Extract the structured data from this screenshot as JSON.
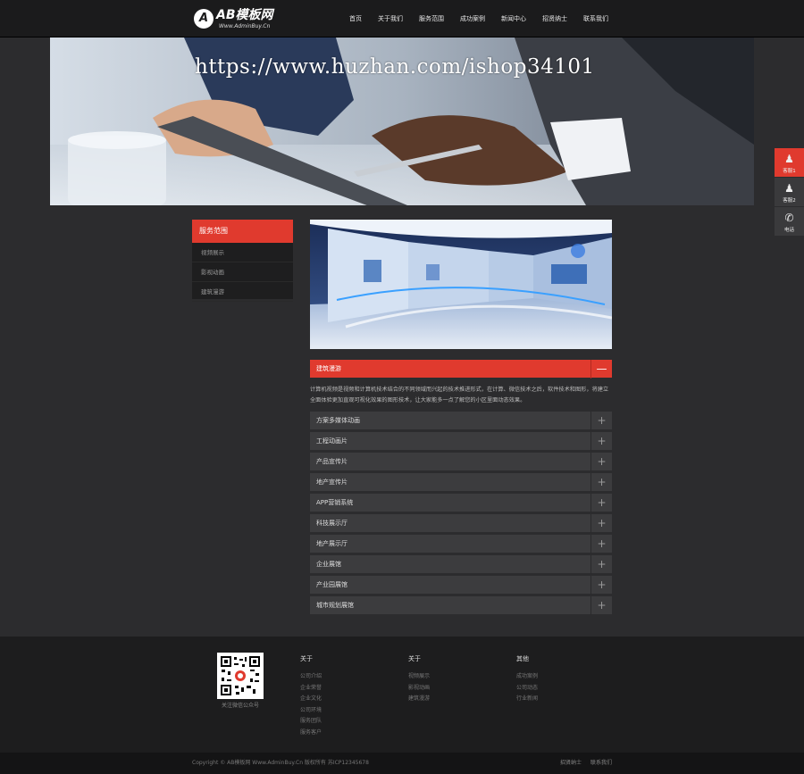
{
  "header": {
    "logo_mark": "A",
    "logo_text": "AB模板网",
    "logo_sub": "Www.AdminBuy.Cn",
    "nav": [
      "首页",
      "关于我们",
      "服务范围",
      "成功案例",
      "新闻中心",
      "招贤纳士",
      "联系我们"
    ]
  },
  "banner": {
    "watermark": "https://www.huzhan.com/ishop34101"
  },
  "sidebar": {
    "title": "服务范围",
    "items": [
      "视频展示",
      "影视动画",
      "建筑漫游"
    ]
  },
  "accordion": {
    "items": [
      {
        "label": "建筑漫游",
        "toggle": "—"
      },
      {
        "label": "方案多媒体动画",
        "toggle": "+"
      },
      {
        "label": "工程动画片",
        "toggle": "+"
      },
      {
        "label": "产品宣传片",
        "toggle": "+"
      },
      {
        "label": "地产宣传片",
        "toggle": "+"
      },
      {
        "label": "APP营销系统",
        "toggle": "+"
      },
      {
        "label": "科技展示厅",
        "toggle": "+"
      },
      {
        "label": "地产展示厅",
        "toggle": "+"
      },
      {
        "label": "企业展馆",
        "toggle": "+"
      },
      {
        "label": "产业园展馆",
        "toggle": "+"
      },
      {
        "label": "城市规划展馆",
        "toggle": "+"
      }
    ],
    "active_description": "计算机视频是视频和计算机技术结合的不同领域而兴起的技术推进形式，在计算、微信技术之后，软件技术和图形，将建立全面体验更加直观可视化效果的图形技术，让大家能多一点了解您的小区里面动态效果。"
  },
  "float_bar": [
    {
      "icon": "qq-icon",
      "glyph": "♟",
      "label": "客服1"
    },
    {
      "icon": "qq-icon",
      "glyph": "♟",
      "label": "客服2"
    },
    {
      "icon": "phone-icon",
      "glyph": "✆",
      "label": "电话"
    }
  ],
  "footer": {
    "qr_caption": "关注微信公众号",
    "columns": [
      {
        "title": "关于",
        "links": [
          "公司介绍",
          "企业荣誉",
          "企业文化",
          "公司环境",
          "服务团队",
          "服务客户"
        ]
      },
      {
        "title": "关于",
        "links": [
          "视频展示",
          "影视动画",
          "建筑漫游"
        ]
      },
      {
        "title": "其他",
        "links": [
          "成功案例",
          "公司动态",
          "行业新闻"
        ]
      }
    ],
    "copyright": "Copyright © AB模板网 Www.AdminBuy.Cn 版权所有    苏ICP12345678",
    "bottom_links": [
      "招贤纳士",
      "联系我们"
    ]
  },
  "colors": {
    "accent": "#e03a2e",
    "header_bg": "#1b1b1c",
    "body_bg": "#2c2c2e",
    "footer_bg": "#1d1d1e"
  }
}
